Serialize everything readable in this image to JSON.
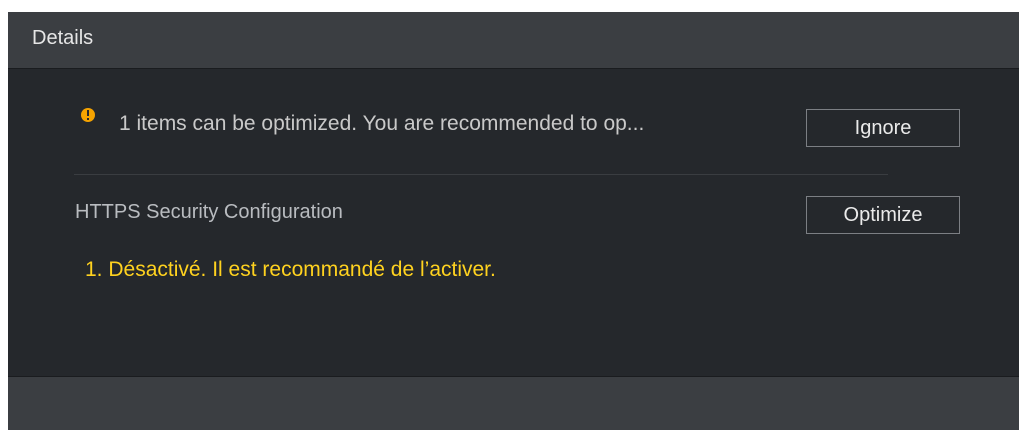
{
  "dialog": {
    "title": "Details"
  },
  "summary": {
    "icon": "warning-icon",
    "icon_color": "#f5a300",
    "text": "1 items can be optimized. You are recommended to op...",
    "ignore_label": "Ignore"
  },
  "items": [
    {
      "name": "HTTPS Security Configuration",
      "action_label": "Optimize",
      "detail": "1. Désactivé. Il est recommandé de l’activer.",
      "detail_color": "#ffd21f"
    }
  ]
}
